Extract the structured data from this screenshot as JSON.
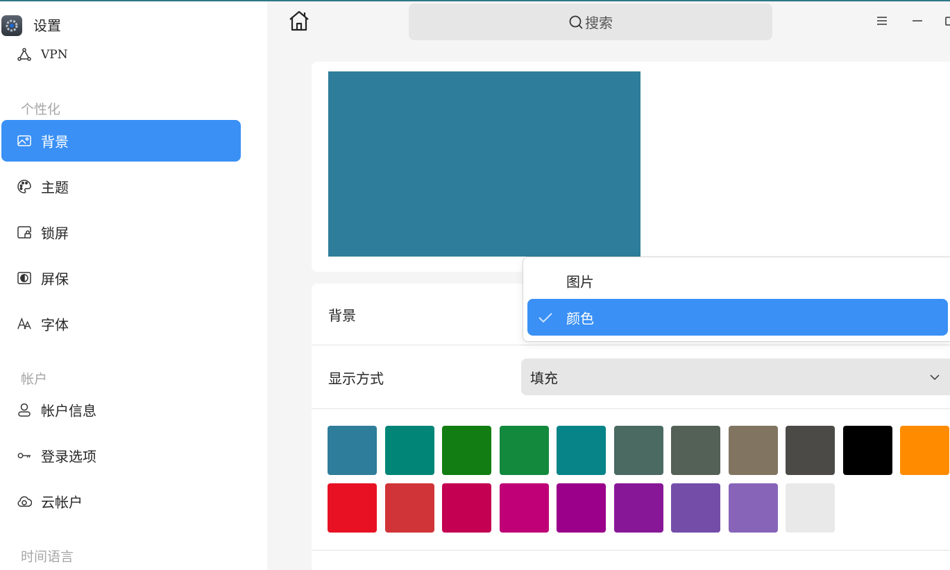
{
  "app": {
    "title": "设置"
  },
  "sidebar": {
    "vpn_label": "VPN",
    "sections": {
      "personalization": "个性化",
      "accounts": "帐户",
      "time_language": "时间语言"
    },
    "items": [
      {
        "label": "背景",
        "icon": "image-icon",
        "active": true
      },
      {
        "label": "主题",
        "icon": "palette-icon"
      },
      {
        "label": "锁屏",
        "icon": "lock-screen-icon"
      },
      {
        "label": "屏保",
        "icon": "screensaver-icon"
      },
      {
        "label": "字体",
        "icon": "font-icon"
      },
      {
        "label": "帐户信息",
        "icon": "user-icon"
      },
      {
        "label": "登录选项",
        "icon": "key-icon"
      },
      {
        "label": "云帐户",
        "icon": "cloud-icon"
      }
    ]
  },
  "topbar": {
    "search_placeholder": "搜索"
  },
  "background": {
    "label": "背景",
    "options": [
      "图片",
      "颜色"
    ],
    "selected": "颜色",
    "preview_color": "#2e7d9a"
  },
  "display_mode": {
    "label": "显示方式",
    "value": "填充"
  },
  "colors": {
    "accent": "#3a90f5",
    "swatches": [
      "#2e7d9a",
      "#008577",
      "#127d12",
      "#12893d",
      "#068488",
      "#4a6a62",
      "#546156",
      "#817562",
      "#4b4a47",
      "#000000",
      "#ff8c00",
      "#e81123",
      "#d13438",
      "#c30052",
      "#bf0077",
      "#9a0089",
      "#881798",
      "#744da9",
      "#8764b8",
      "#e9e9e9"
    ]
  }
}
